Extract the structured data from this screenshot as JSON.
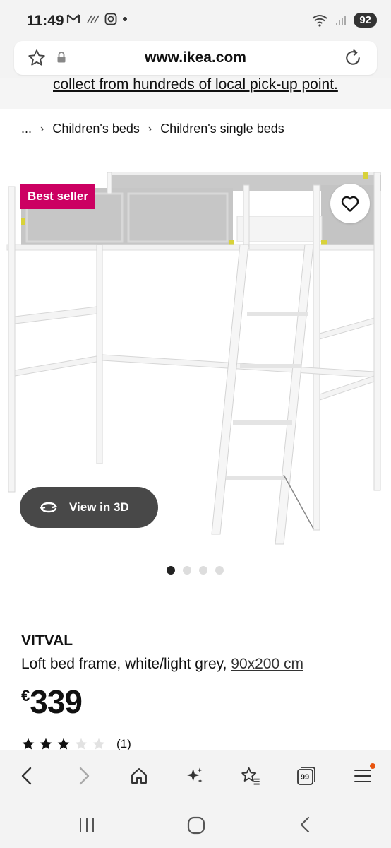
{
  "status_bar": {
    "time": "11:49",
    "icons_left": [
      "gmail-icon",
      "wifi-calling-icon",
      "instagram-icon",
      "dot"
    ],
    "battery": "92"
  },
  "browser": {
    "url": "www.ikea.com"
  },
  "banner": {
    "text": "collect from hundreds of local pick-up point."
  },
  "breadcrumb": {
    "ellipsis": "...",
    "items": [
      "Children's beds",
      "Children's single beds"
    ]
  },
  "product": {
    "badge": "Best seller",
    "view_3d_label": "View in 3D",
    "carousel": {
      "count": 4,
      "active": 0
    },
    "name": "VITVAL",
    "description": "Loft bed frame, white/light grey, ",
    "size": "90x200 cm",
    "currency": "€",
    "price": "339",
    "rating": 3,
    "rating_max": 5,
    "review_count": "(1)"
  },
  "toolbar": {
    "tabs_count": "99"
  },
  "colors": {
    "badge": "#cc0062",
    "view3d_bg": "#484848",
    "notif": "#e8540e"
  }
}
